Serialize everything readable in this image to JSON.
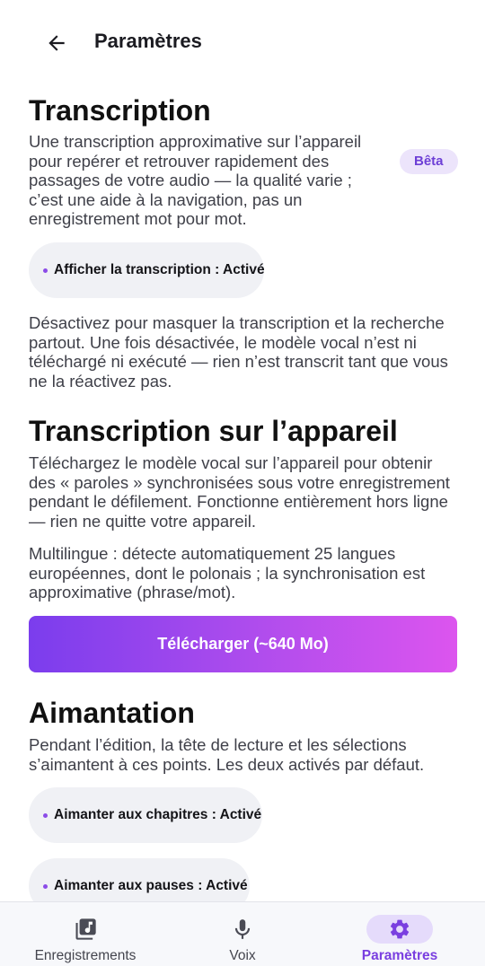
{
  "header": {
    "title": "Paramètres"
  },
  "transcription": {
    "title": "Transcription",
    "description": "Une transcription approximative sur l’appareil pour repérer et retrouver rapidement des passages de votre audio — la qualité varie ; c’est une aide à la navigation, pas un enregistrement mot pour mot.",
    "badge": "Bêta",
    "toggle_label": "Afficher la transcription : Activé",
    "note": "Désactivez pour masquer la transcription et la recherche partout. Une fois désactivée, le modèle vocal n’est ni téléchargé ni exécuté — rien n’est transcrit tant que vous ne la réactivez pas."
  },
  "on_device": {
    "title": "Transcription sur l’appareil",
    "description": "Téléchargez le modèle vocal sur l’appareil pour obtenir des « paroles » synchronisées sous votre enregistrement pendant le défilement. Fonctionne entièrement hors ligne — rien ne quitte votre appareil.",
    "languages": "Multilingue : détecte automatiquement 25 langues européennes, dont le polonais ; la synchronisation est approximative (phrase/mot).",
    "download_label": "Télécharger (~640 Mo)"
  },
  "snapping": {
    "title": "Aimantation",
    "description": "Pendant l’édition, la tête de lecture et les sélections s’aimantent à ces points. Les deux activés par défaut.",
    "chapters_label": "Aimanter aux chapitres : Activé",
    "pauses_label": "Aimanter aux pauses : Activé"
  },
  "nav": {
    "items": [
      {
        "label": "Enregistrements",
        "icon": "recordings-icon"
      },
      {
        "label": "Voix",
        "icon": "microphone-icon"
      },
      {
        "label": "Paramètres",
        "icon": "gear-icon"
      }
    ],
    "active": "Paramètres"
  },
  "colors": {
    "accent": "#7a3fe0",
    "badge_bg": "#ece4fb",
    "chip_bg": "#f0f1f5",
    "gradient_start": "#7b3ded",
    "gradient_end": "#dc55ee"
  }
}
